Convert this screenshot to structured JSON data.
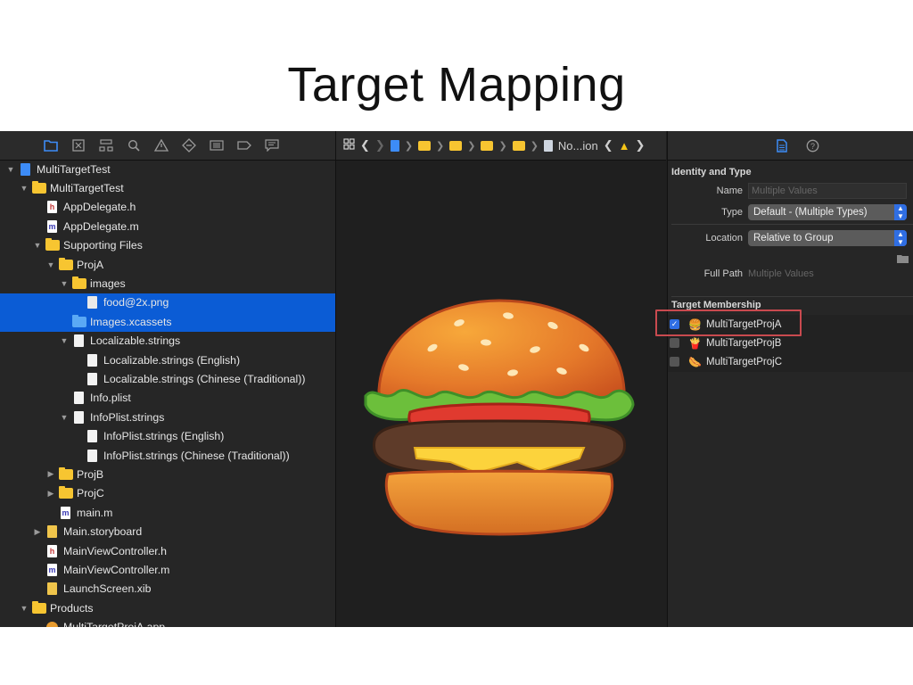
{
  "slide": {
    "title": "Target Mapping"
  },
  "navigator": {
    "toolbar_icons": [
      "folder-icon",
      "source-control-icon",
      "hierarchy-icon",
      "search-icon",
      "warning-icon",
      "test-icon",
      "debug-icon",
      "breakpoint-icon",
      "report-icon"
    ],
    "rows": [
      {
        "label": "MultiTargetTest",
        "depth": 0,
        "disclosure": "open",
        "icon": "project"
      },
      {
        "label": "MultiTargetTest",
        "depth": 1,
        "disclosure": "open",
        "icon": "folder"
      },
      {
        "label": "AppDelegate.h",
        "depth": 2,
        "disclosure": "none",
        "icon": "h"
      },
      {
        "label": "AppDelegate.m",
        "depth": 2,
        "disclosure": "none",
        "icon": "m"
      },
      {
        "label": "Supporting Files",
        "depth": 2,
        "disclosure": "open",
        "icon": "folder"
      },
      {
        "label": "ProjA",
        "depth": 3,
        "disclosure": "open",
        "icon": "folder"
      },
      {
        "label": "images",
        "depth": 4,
        "disclosure": "open",
        "icon": "folder"
      },
      {
        "label": "food@2x.png",
        "depth": 5,
        "disclosure": "none",
        "icon": "png",
        "selected": true
      },
      {
        "label": "Images.xcassets",
        "depth": 4,
        "disclosure": "none",
        "icon": "assets",
        "selected": true
      },
      {
        "label": "Localizable.strings",
        "depth": 4,
        "disclosure": "open",
        "icon": "plain"
      },
      {
        "label": "Localizable.strings (English)",
        "depth": 5,
        "disclosure": "none",
        "icon": "plain"
      },
      {
        "label": "Localizable.strings (Chinese (Traditional))",
        "depth": 5,
        "disclosure": "none",
        "icon": "plain"
      },
      {
        "label": "Info.plist",
        "depth": 4,
        "disclosure": "none",
        "icon": "plain"
      },
      {
        "label": "InfoPlist.strings",
        "depth": 4,
        "disclosure": "open",
        "icon": "plain"
      },
      {
        "label": "InfoPlist.strings (English)",
        "depth": 5,
        "disclosure": "none",
        "icon": "plain"
      },
      {
        "label": "InfoPlist.strings (Chinese (Traditional))",
        "depth": 5,
        "disclosure": "none",
        "icon": "plain"
      },
      {
        "label": "ProjB",
        "depth": 3,
        "disclosure": "closed",
        "icon": "folder"
      },
      {
        "label": "ProjC",
        "depth": 3,
        "disclosure": "closed",
        "icon": "folder"
      },
      {
        "label": "main.m",
        "depth": 3,
        "disclosure": "none",
        "icon": "m"
      },
      {
        "label": "Main.storyboard",
        "depth": 2,
        "disclosure": "closed",
        "icon": "xib"
      },
      {
        "label": "MainViewController.h",
        "depth": 2,
        "disclosure": "none",
        "icon": "h"
      },
      {
        "label": "MainViewController.m",
        "depth": 2,
        "disclosure": "none",
        "icon": "m"
      },
      {
        "label": "LaunchScreen.xib",
        "depth": 2,
        "disclosure": "none",
        "icon": "xib"
      },
      {
        "label": "Products",
        "depth": 1,
        "disclosure": "open",
        "icon": "folder"
      },
      {
        "label": "MultiTargetProjA.app",
        "depth": 2,
        "disclosure": "none",
        "icon": "app"
      }
    ]
  },
  "editor": {
    "jumpbar": {
      "breadcrumb_tail": "No...ion"
    },
    "preview": "hamburger-image"
  },
  "inspector": {
    "identity": {
      "section_title": "Identity and Type",
      "name_label": "Name",
      "name_placeholder": "Multiple Values",
      "type_label": "Type",
      "type_value": "Default - (Multiple Types)",
      "location_label": "Location",
      "location_value": "Relative to Group",
      "full_path_label": "Full Path",
      "full_path_value": "Multiple Values"
    },
    "membership": {
      "section_title": "Target Membership",
      "targets": [
        {
          "label": "MultiTargetProjA",
          "checked": true,
          "icon": "🍔"
        },
        {
          "label": "MultiTargetProjB",
          "checked": false,
          "icon": "🍟"
        },
        {
          "label": "MultiTargetProjC",
          "checked": false,
          "icon": "🌭"
        }
      ]
    }
  },
  "colors": {
    "selection": "#0b5cd5",
    "accent": "#2f6ee3",
    "highlight_box": "#c94a4f"
  }
}
